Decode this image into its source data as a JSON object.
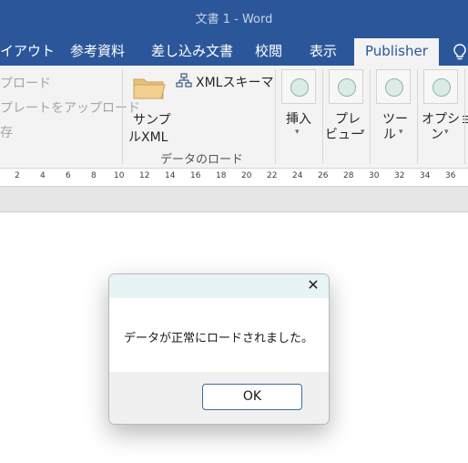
{
  "window": {
    "title": "文書 1 - Word"
  },
  "tabs": [
    {
      "label": "イアウト"
    },
    {
      "label": "参考資料"
    },
    {
      "label": "差し込み文書"
    },
    {
      "label": "校閲"
    },
    {
      "label": "表示"
    },
    {
      "label": "Publisher"
    }
  ],
  "ribbon": {
    "upload": "プロード",
    "template_upload": "プレートをアップロード",
    "cutoff": "存",
    "sample_line1": "サンプ",
    "sample_line2": "ルXML",
    "xml_schema": "XMLスキーマ",
    "group_label": "データのロード",
    "insert": "挿入",
    "preview_line1": "プレ",
    "preview_line2": "ビュー",
    "tools_line1": "ツー",
    "tools_line2": "ル",
    "options_line1": "オプショ",
    "options_line2": "ン",
    "caret": "▾"
  },
  "ruler": {
    "ticks": [
      "2",
      "4",
      "6",
      "8",
      "10",
      "12",
      "14",
      "16",
      "18",
      "20",
      "22",
      "24",
      "26",
      "28",
      "30",
      "32",
      "34",
      "36"
    ]
  },
  "dialog": {
    "message": "データが正常にロードされました。",
    "ok_label": "OK",
    "close_glyph": "✕"
  }
}
